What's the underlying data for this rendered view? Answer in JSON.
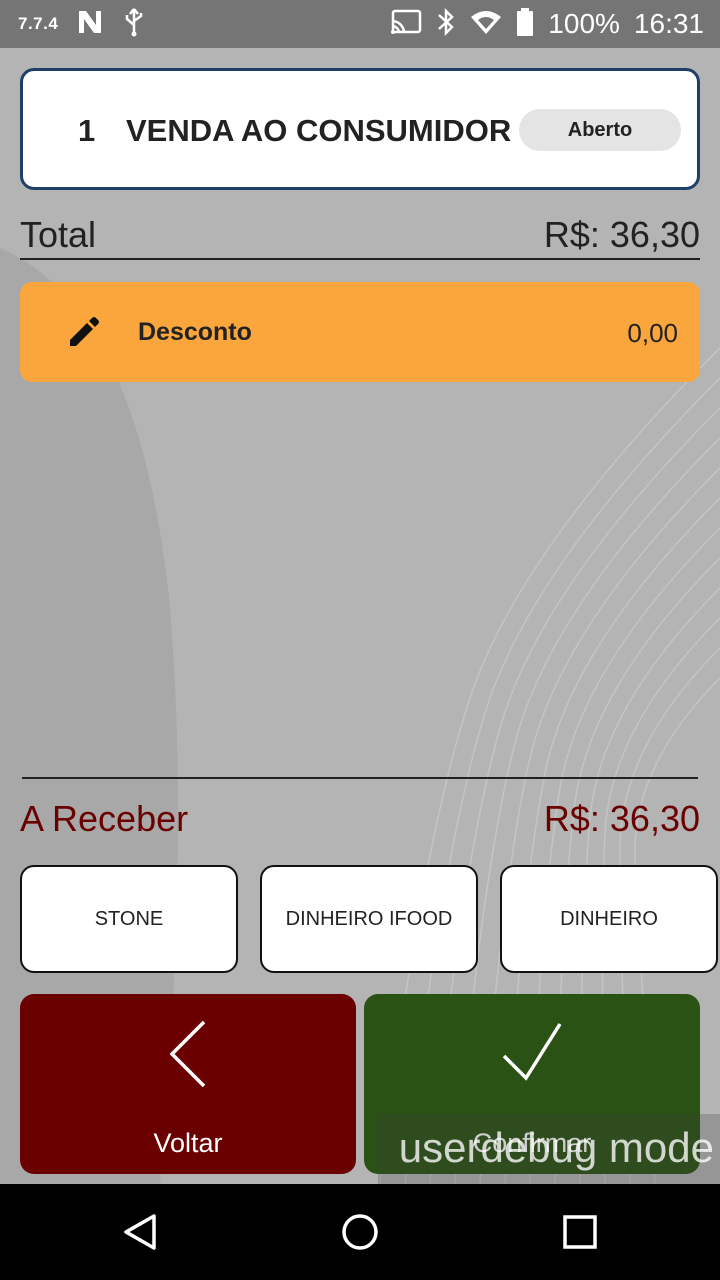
{
  "status_bar": {
    "version": "7.7.4",
    "battery": "100%",
    "time": "16:31",
    "icons": [
      "n-notification-icon",
      "usb-icon",
      "cast-icon",
      "bluetooth-icon",
      "wifi-icon",
      "battery-icon"
    ]
  },
  "order": {
    "number": "1",
    "title": "VENDA AO CONSUMIDOR",
    "status": "Aberto"
  },
  "total": {
    "label": "Total",
    "value": "R$: 36,30"
  },
  "discount": {
    "label": "Desconto",
    "value": "0,00",
    "icon": "pencil-icon"
  },
  "receivable": {
    "label": "A Receber",
    "value": "R$: 36,30"
  },
  "payment_methods": [
    {
      "label": "STONE"
    },
    {
      "label": "DINHEIRO IFOOD"
    },
    {
      "label": "DINHEIRO"
    }
  ],
  "actions": {
    "back_label": "Voltar",
    "confirm_label": "Confirmar"
  },
  "overlay": {
    "text": "userdebug mode"
  },
  "colors": {
    "accent_discount": "#fba63c",
    "back_button": "#6b0000",
    "confirm_button": "#2a5214",
    "receivable_text": "#6b0000",
    "header_border": "#1f3f66"
  }
}
